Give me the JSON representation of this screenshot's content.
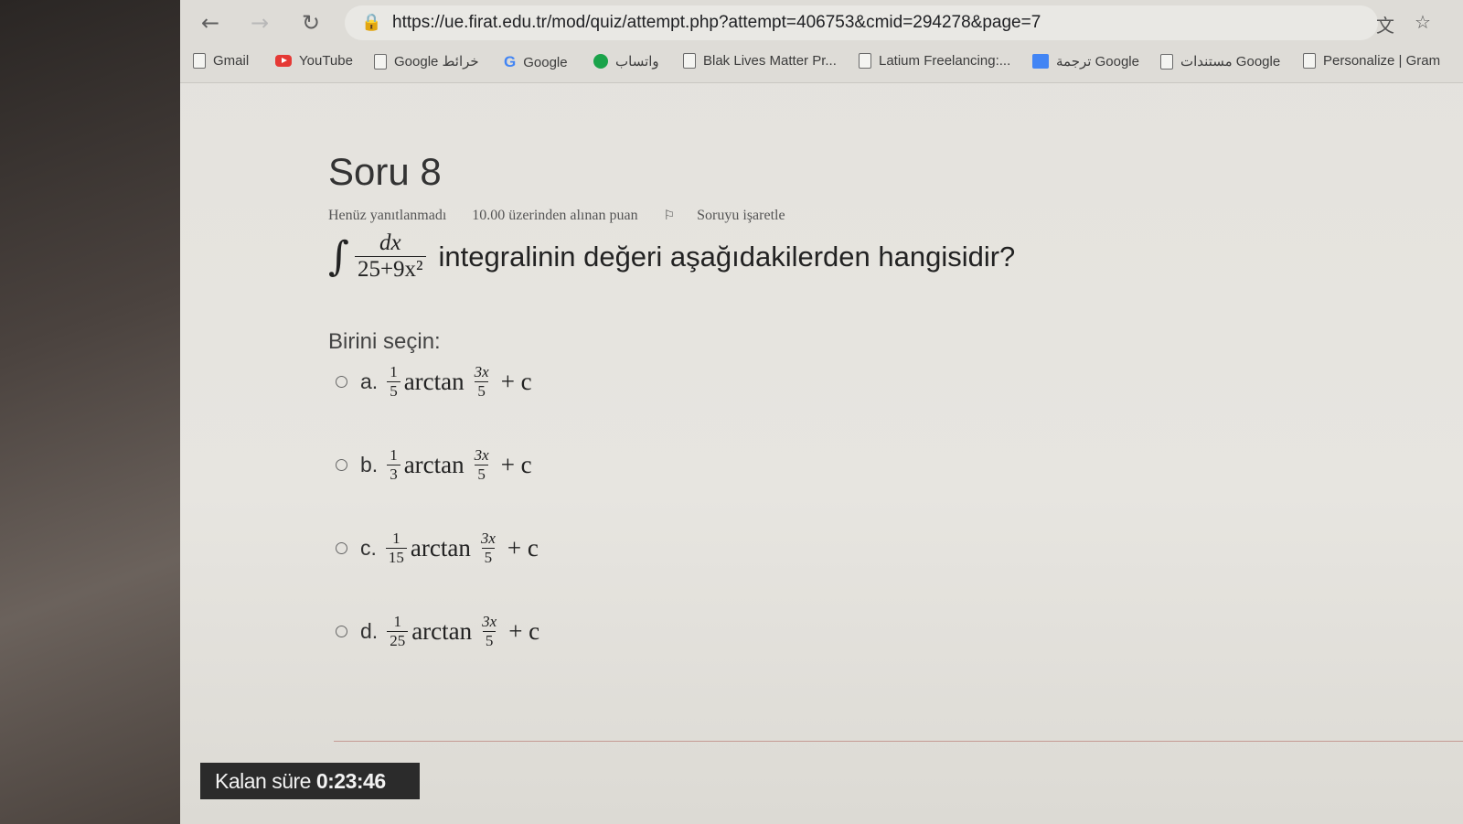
{
  "browser": {
    "url": "https://ue.firat.edu.tr/mod/quiz/attempt.php?attempt=406753&cmid=294278&page=7",
    "bookmarks": [
      {
        "label": "Gmail",
        "icon": "page-icon"
      },
      {
        "label": "YouTube",
        "icon": "youtube-icon"
      },
      {
        "label": "Google خرائط",
        "icon": "page-icon"
      },
      {
        "label": "Google",
        "icon": "google-icon"
      },
      {
        "label": "واتساب",
        "icon": "whatsapp-icon"
      },
      {
        "label": "Blak Lives Matter Pr...",
        "icon": "page-icon"
      },
      {
        "label": "Latium Freelancing:...",
        "icon": "page-icon"
      },
      {
        "label": "ترجمة Google",
        "icon": "translate-icon"
      },
      {
        "label": "مستندات Google",
        "icon": "page-icon"
      },
      {
        "label": "Personalize | Gram",
        "icon": "page-icon"
      }
    ]
  },
  "question": {
    "title": "Soru 8",
    "status": "Henüz yanıtlanmadı",
    "points": "10.00 üzerinden alınan puan",
    "flag_label": "Soruyu işaretle",
    "integral_numerator": "dx",
    "integral_denominator": "25+9x²",
    "text": "integralinin değeri aşağıdakilerden hangisidir?",
    "choose_label": "Birini seçin:",
    "options": [
      {
        "letter": "a.",
        "coef_num": "1",
        "coef_den": "5",
        "func": "arctan",
        "arg_num": "3x",
        "arg_den": "5",
        "suffix": "+ c"
      },
      {
        "letter": "b.",
        "coef_num": "1",
        "coef_den": "3",
        "func": "arctan",
        "arg_num": "3x",
        "arg_den": "5",
        "suffix": "+ c"
      },
      {
        "letter": "c.",
        "coef_num": "1",
        "coef_den": "15",
        "func": "arctan",
        "arg_num": "3x",
        "arg_den": "5",
        "suffix": "+ c"
      },
      {
        "letter": "d.",
        "coef_num": "1",
        "coef_den": "25",
        "func": "arctan",
        "arg_num": "3x",
        "arg_den": "5",
        "suffix": "+ c"
      }
    ]
  },
  "timer": {
    "label": "Kalan süre",
    "value": "0:23:46"
  }
}
